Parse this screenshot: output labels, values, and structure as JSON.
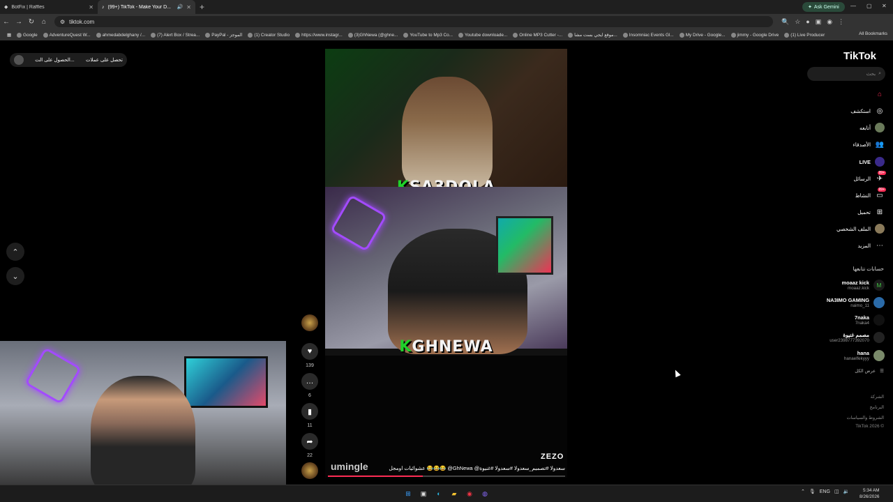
{
  "browser": {
    "tabs": [
      {
        "title": "BotFix | Raffles",
        "active": false
      },
      {
        "title": "(99+) TikTok - Make Your D...",
        "active": true
      }
    ],
    "gemini_label": "Ask Gemini",
    "url": "tiktok.com",
    "bookmarks": [
      "Google",
      "AdventureQuest W...",
      "ahmedabdelghany /...",
      "(7) Alert Box / Strea...",
      "PayPal - الموجز",
      "(1) Creator Studio",
      "https://www.instagr...",
      "(3)GhNewa (@ghne...",
      "YouTube to Mp3 Co...",
      "Youtube downloade...",
      "Online MP3 Cutter -...",
      "موقع ايجي بست مشا...",
      "Insomniac Events Gl...",
      "My Drive - Google...",
      "jimmy - Google Drive",
      "(1) Live Producer"
    ],
    "all_bookmarks": "All Bookmarks"
  },
  "page": {
    "get_app": "تحصل على عملات",
    "get_app2": "الحصول على الت..."
  },
  "video": {
    "name_top": {
      "k": "K",
      "rest": "SA3DOLA"
    },
    "name_bottom": {
      "k": "K",
      "rest": "GHNEWA"
    },
    "author": "ZEZO",
    "watermark": "umingle",
    "description": "عشوائيات اومجل 😂😂😂 @GhNewa @سعدولا #تصميم_سعدولا #سعدولا #غنيوة",
    "progress_fraction": 0.4
  },
  "actions": {
    "likes": "139",
    "comments": "6",
    "saves": "11",
    "shares": "22"
  },
  "sidebar": {
    "logo": "TikTok",
    "search_placeholder": "بحث",
    "nav": [
      {
        "label": "",
        "icon": "home-icon"
      },
      {
        "label": "استكشف",
        "icon": "compass-icon"
      },
      {
        "label": "أتابعه",
        "icon": "following-icon"
      },
      {
        "label": "الأصدقاء",
        "icon": "friends-icon"
      },
      {
        "label": "LIVE",
        "icon": "live-icon"
      },
      {
        "label": "الرسائل",
        "icon": "messages-icon",
        "badge": "99+"
      },
      {
        "label": "النشاط",
        "icon": "activity-icon",
        "badge": "99+"
      },
      {
        "label": "تحميل",
        "icon": "upload-icon"
      },
      {
        "label": "الملف الشخصي",
        "icon": "profile-icon"
      },
      {
        "label": "المزيد",
        "icon": "more-icon"
      }
    ],
    "following_title": "حسابات تتابعها",
    "accounts": [
      {
        "name": "moaaz kick",
        "user": "moaaz.kick"
      },
      {
        "name": "NA3IMO GAMING",
        "user": "naimo_11"
      },
      {
        "name": "7naka",
        "user": "7naka4"
      },
      {
        "name": "مصمم غنيوة",
        "user": "user2398777392070"
      },
      {
        "name": "hana",
        "user": "hanaelfekyyy"
      }
    ],
    "see_all": "عرض الكل",
    "footer": [
      "الشركة",
      "البرنامج",
      "الشروط والسياسات",
      "TikTok 2026 ©"
    ]
  },
  "taskbar": {
    "lang": "ENG",
    "time": "5:34 AM",
    "date": "8/26/2026"
  }
}
